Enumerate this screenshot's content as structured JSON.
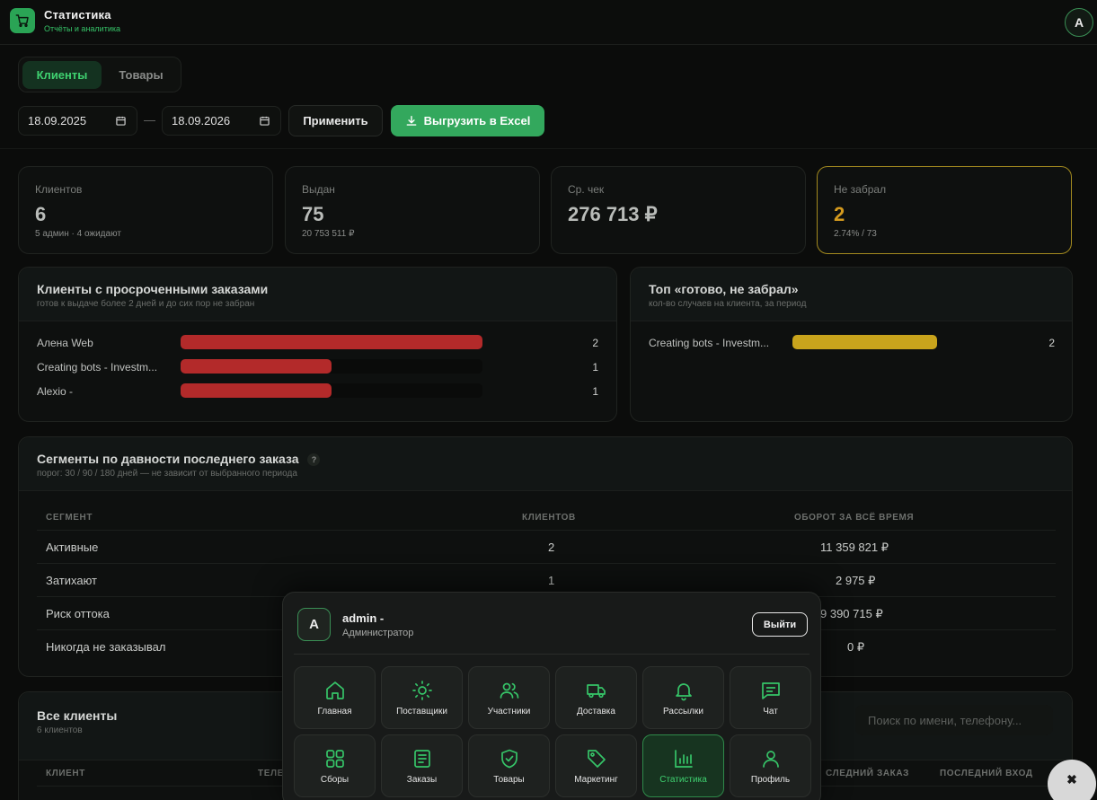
{
  "header": {
    "title": "Статистика",
    "subtitle": "Отчёты и аналитика",
    "avatar_letter": "A"
  },
  "tabs": [
    {
      "label": "Клиенты",
      "active": true
    },
    {
      "label": "Товары",
      "active": false
    }
  ],
  "filters": {
    "date_from": "18.09.2025",
    "date_to": "18.09.2026",
    "separator": "—",
    "apply_label": "Применить",
    "export_label": "Выгрузить в Excel"
  },
  "stats": [
    {
      "label": "Клиентов",
      "value": "6",
      "sub": "5 админ · 4 ожидают"
    },
    {
      "label": "Выдан",
      "value": "75",
      "sub": "20 753 511 ₽"
    },
    {
      "label": "Ср. чек",
      "value": "276 713 ₽",
      "sub": ""
    },
    {
      "label": "Не забрал",
      "value": "2",
      "sub": "2.74% / 73"
    }
  ],
  "overdue": {
    "title": "Клиенты с просроченными заказами",
    "subtitle": "готов к выдаче более 2 дней и до сих пор не забран",
    "color": "#b32a2a",
    "max": 2,
    "rows": [
      {
        "name": "Алена Web",
        "value": 2
      },
      {
        "name": "Creating bots - Investm...",
        "value": 1
      },
      {
        "name": "Alexio -",
        "value": 1
      }
    ]
  },
  "top_ready": {
    "title": "Топ «готово, не забрал»",
    "subtitle": "кол-во случаев на клиента, за период",
    "color": "#c9a41c",
    "max": 2,
    "rows": [
      {
        "name": "Creating bots - Investm...",
        "value": 2
      }
    ]
  },
  "segments": {
    "title": "Сегменты по давности последнего заказа",
    "help_icon": "question-icon",
    "help": "?",
    "subtitle": "порог: 30 / 90 / 180 дней — не зависит от выбранного периода",
    "columns": [
      "СЕГМЕНТ",
      "КЛИЕНТОВ",
      "ОБОРОТ ЗА ВСЁ ВРЕМЯ"
    ],
    "rows": [
      {
        "segment": "Активные",
        "clients": "2",
        "turnover": "11 359 821 ₽"
      },
      {
        "segment": "Затихают",
        "clients": "1",
        "turnover": "2 975 ₽"
      },
      {
        "segment": "Риск оттока",
        "clients": "",
        "turnover": "9 390 715 ₽"
      },
      {
        "segment": "Никогда не заказывал",
        "clients": "",
        "turnover": "0 ₽"
      }
    ]
  },
  "all_clients": {
    "title": "Все клиенты",
    "subtitle": "6 клиентов",
    "search_placeholder": "Поиск по имени, телефону...",
    "columns": [
      "КЛИЕНТ",
      "ТЕЛЕ",
      "СЛЕДНИЙ ЗАКАЗ",
      "ПОСЛЕДНИЙ ВХОД"
    ]
  },
  "menu": {
    "avatar_letter": "A",
    "user_name": "admin -",
    "role": "Администратор",
    "logout_label": "Выйти",
    "items": [
      {
        "label": "Главная",
        "icon": "home-icon"
      },
      {
        "label": "Поставщики",
        "icon": "sun-icon"
      },
      {
        "label": "Участники",
        "icon": "users-icon"
      },
      {
        "label": "Доставка",
        "icon": "truck-icon"
      },
      {
        "label": "Рассылки",
        "icon": "bell-icon"
      },
      {
        "label": "Чат",
        "icon": "chat-icon"
      },
      {
        "label": "Сборы",
        "icon": "grid-icon"
      },
      {
        "label": "Заказы",
        "icon": "document-icon"
      },
      {
        "label": "Товары",
        "icon": "shield-check-icon"
      },
      {
        "label": "Маркетинг",
        "icon": "tag-icon"
      },
      {
        "label": "Статистика",
        "icon": "chart-icon",
        "active": true
      },
      {
        "label": "Профиль",
        "icon": "user-icon"
      }
    ]
  },
  "close_fab": "✖",
  "colors": {
    "accent": "#33a85d",
    "warning": "#d49a1e",
    "danger": "#b32a2a"
  }
}
